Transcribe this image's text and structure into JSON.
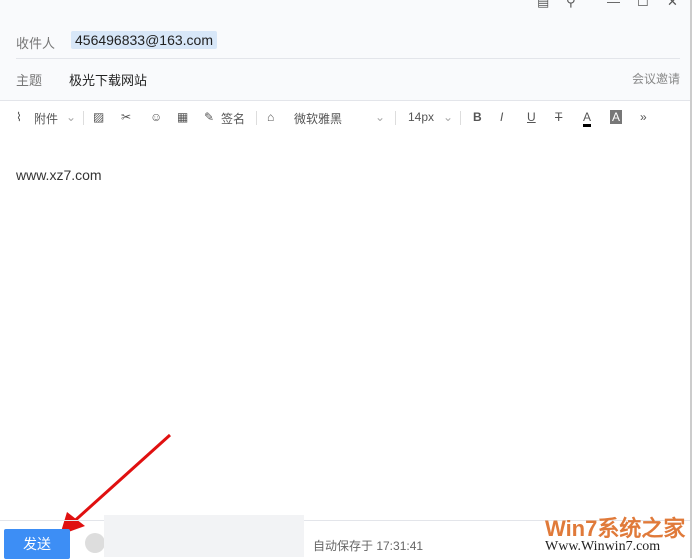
{
  "header": {
    "to_label": "收件人",
    "to_value": "456496833@163.com",
    "subject_label": "主题",
    "subject_value": "极光下载网站",
    "meeting_invite": "会议邀请"
  },
  "toolbar": {
    "attach": "附件",
    "signature": "签名",
    "font": "微软雅黑",
    "size": "14px"
  },
  "body": {
    "text": "www.xz7.com"
  },
  "footer": {
    "send": "发送",
    "autosave": "自动保存于 17:31:41"
  },
  "watermark": {
    "brand": "Win7系统之家",
    "url": "Www.Winwin7.com"
  }
}
